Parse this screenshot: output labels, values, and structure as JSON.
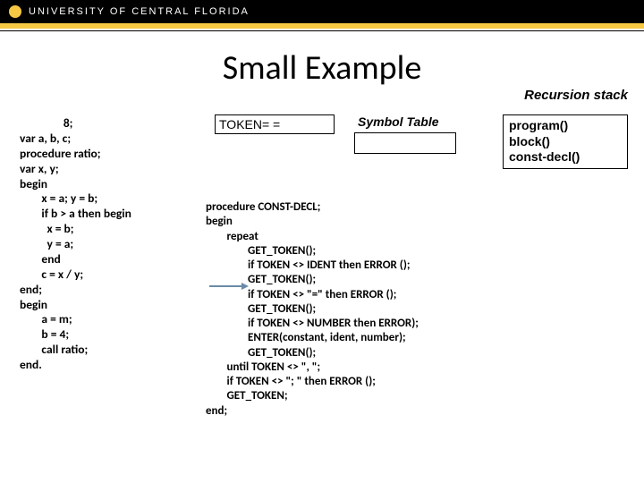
{
  "brand": {
    "name": "UNIVERSITY OF CENTRAL FLORIDA"
  },
  "title": "Small Example",
  "recursion_label": "Recursion stack",
  "token_box": "TOKEN= =",
  "symbol_label": "Symbol Table",
  "stack": {
    "l1": "program()",
    "l2": "block()",
    "l3": "const-decl()"
  },
  "left_code": "                8;\nvar a, b, c;\nprocedure ratio;\nvar x, y;\nbegin\n        x = a; y = b;\n        if b > a then begin\n          x = b;\n          y = a;\n        end\n        c = x / y;\nend;\nbegin\n        a = m;\n        b = 4;\n        call ratio;\nend.",
  "proc_code": "procedure CONST-DECL;\nbegin\n        repeat\n                GET_TOKEN();\n                if TOKEN <> IDENT then ERROR ();\n                GET_TOKEN();\n                if TOKEN <> \"=\" then ERROR ();\n                GET_TOKEN();\n                if TOKEN <> NUMBER then ERROR);\n                ENTER(constant, ident, number);\n                GET_TOKEN();\n        until TOKEN <> \", \";\n        if TOKEN <> \"; \" then ERROR ();\n        GET_TOKEN;\nend;"
}
